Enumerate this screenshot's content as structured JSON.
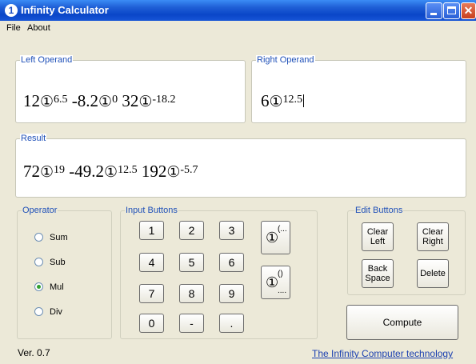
{
  "window": {
    "title": "Infinity Calculator",
    "icon_char": "1",
    "close_char": "✕"
  },
  "menu": {
    "items": [
      "File",
      "About"
    ]
  },
  "left_operand": {
    "label": "Left Operand",
    "terms": [
      {
        "coef": "12",
        "exp": "6.5"
      },
      {
        "coef": "-8.2",
        "exp": "0"
      },
      {
        "coef": "32",
        "exp": "-18.2"
      }
    ]
  },
  "right_operand": {
    "label": "Right Operand",
    "terms": [
      {
        "coef": "6",
        "exp": "12.5"
      }
    ]
  },
  "result": {
    "label": "Result",
    "terms": [
      {
        "coef": "72",
        "exp": "19"
      },
      {
        "coef": "-49.2",
        "exp": "12.5"
      },
      {
        "coef": "192",
        "exp": "-5.7"
      }
    ]
  },
  "infinity_symbol": "①",
  "operator": {
    "label": "Operator",
    "options": [
      "Sum",
      "Sub",
      "Mul",
      "Div"
    ],
    "selected": "Mul"
  },
  "input_buttons": {
    "label": "Input Buttons",
    "keys": [
      "1",
      "2",
      "3",
      "4",
      "5",
      "6",
      "7",
      "8",
      "9",
      "0",
      "-",
      "."
    ],
    "inf_exp_label": "(...",
    "inf_paren_label": "()",
    "inf_paren_sub": "...."
  },
  "edit_buttons": {
    "label": "Edit Buttons",
    "clear_left": [
      "Clear",
      "Left"
    ],
    "clear_right": [
      "Clear",
      "Right"
    ],
    "back_space": [
      "Back",
      "Space"
    ],
    "delete": "Delete"
  },
  "compute_label": "Compute",
  "footer": {
    "version": "Ver. 0.7",
    "link": "The Infinity Computer technology"
  },
  "colors": {
    "titlebar": "#0a46c8",
    "group_label": "#1f50b8",
    "link": "#1a3fb0",
    "radio_selected": "#31a031"
  }
}
